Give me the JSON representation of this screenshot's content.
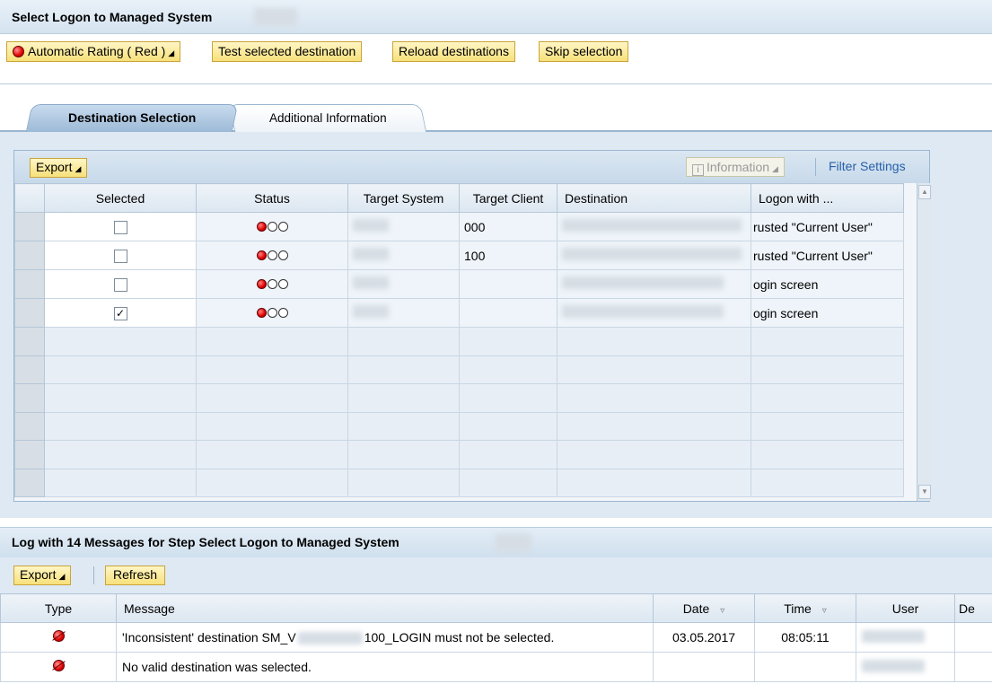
{
  "window": {
    "title": "Select Logon to Managed System"
  },
  "toolbar": {
    "rating_label": "Automatic Rating ( Red )",
    "test_label": "Test selected destination",
    "reload_label": "Reload destinations",
    "skip_label": "Skip selection"
  },
  "tabs": [
    {
      "label": "Destination Selection",
      "active": true
    },
    {
      "label": "Additional Information",
      "active": false
    }
  ],
  "grid": {
    "export_label": "Export",
    "information_label": "Information",
    "filter_label": "Filter Settings",
    "columns": [
      "Selected",
      "Status",
      "Target System",
      "Target Client",
      "Destination",
      "Logon with ..."
    ],
    "rows": [
      {
        "selected": false,
        "status": "red",
        "target_client": "000",
        "logon_with": "rusted \"Current User\""
      },
      {
        "selected": false,
        "status": "red",
        "target_client": "100",
        "logon_with": "rusted \"Current User\""
      },
      {
        "selected": false,
        "status": "red",
        "target_client": "",
        "logon_with": "ogin screen"
      },
      {
        "selected": true,
        "status": "red",
        "target_client": "",
        "logon_with": "ogin screen"
      }
    ]
  },
  "log": {
    "title": "Log with 14 Messages for Step Select Logon to Managed System",
    "export_label": "Export",
    "refresh_label": "Refresh",
    "columns": [
      "Type",
      "Message",
      "Date",
      "Time",
      "User",
      "De"
    ],
    "rows": [
      {
        "type": "error",
        "message_a": "'Inconsistent' destination SM_V",
        "message_b": "100_LOGIN must not be selected.",
        "date": "03.05.2017",
        "time": "08:05:11"
      },
      {
        "type": "error",
        "message_a": "No valid destination was selected.",
        "message_b": "",
        "date": "",
        "time": ""
      }
    ]
  },
  "colors": {
    "accent": "#2660a8",
    "button_yellow": "#f7e07a",
    "status_red": "#e00000"
  }
}
